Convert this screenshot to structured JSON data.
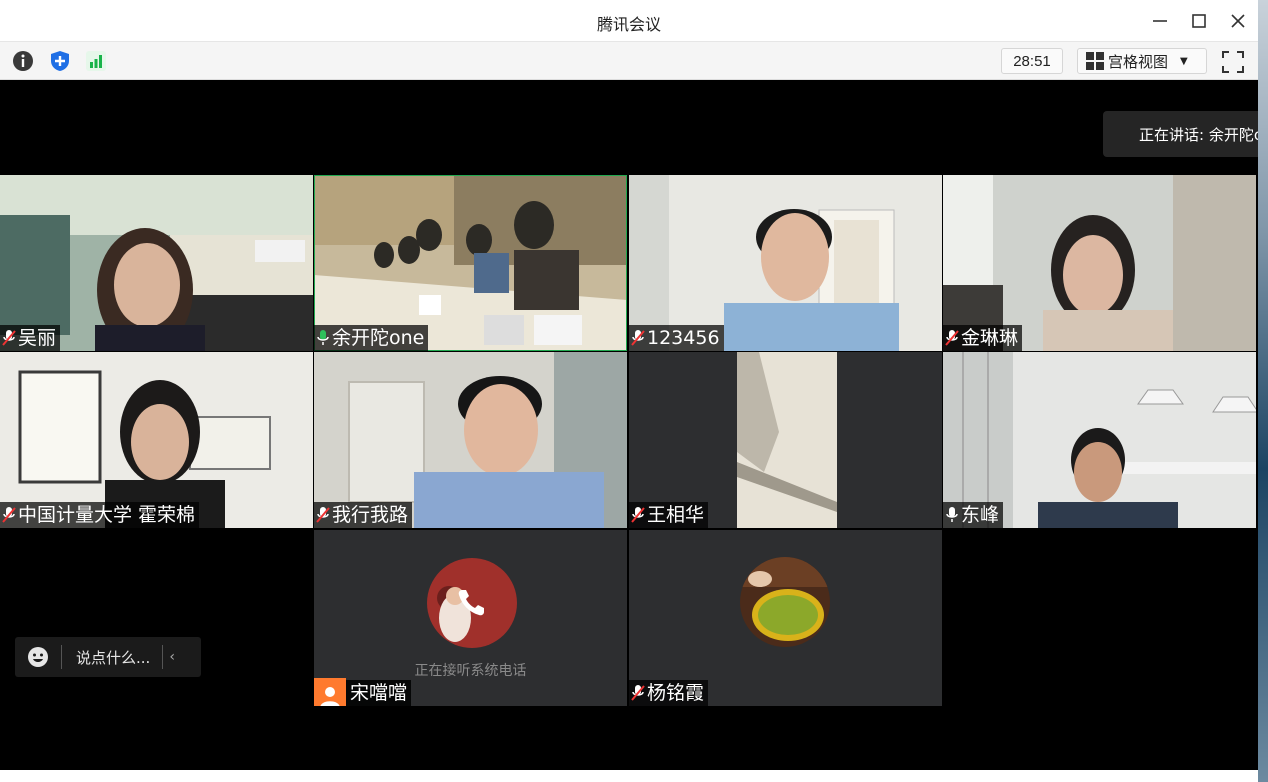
{
  "window": {
    "title": "腾讯会议"
  },
  "toolbar": {
    "timer": "28:51",
    "view_label": "宫格视图",
    "icons": [
      "info-icon",
      "shield-icon",
      "signal-icon"
    ]
  },
  "speaking": {
    "label": "正在讲话: 余开陀one"
  },
  "participants": [
    {
      "name": "吴丽",
      "mic": "muted"
    },
    {
      "name": "余开陀one",
      "mic": "on"
    },
    {
      "name": "123456",
      "mic": "muted"
    },
    {
      "name": "金琳琳",
      "mic": "muted"
    },
    {
      "name": "中国计量大学 霍荣棉",
      "mic": "muted"
    },
    {
      "name": "我行我路",
      "mic": "muted"
    },
    {
      "name": "王相华",
      "mic": "muted"
    },
    {
      "name": "东峰",
      "mic": "on"
    },
    {
      "name": "宋噹噹",
      "mic": "phone",
      "status": "正在接听系统电话"
    },
    {
      "name": "杨铭霞",
      "mic": "muted"
    }
  ],
  "chat": {
    "placeholder": "说点什么..."
  },
  "colors": {
    "active_speaker": "#21a84f",
    "mic_on": "#2ec05b",
    "phone_avatar": "#ff7a2e"
  }
}
